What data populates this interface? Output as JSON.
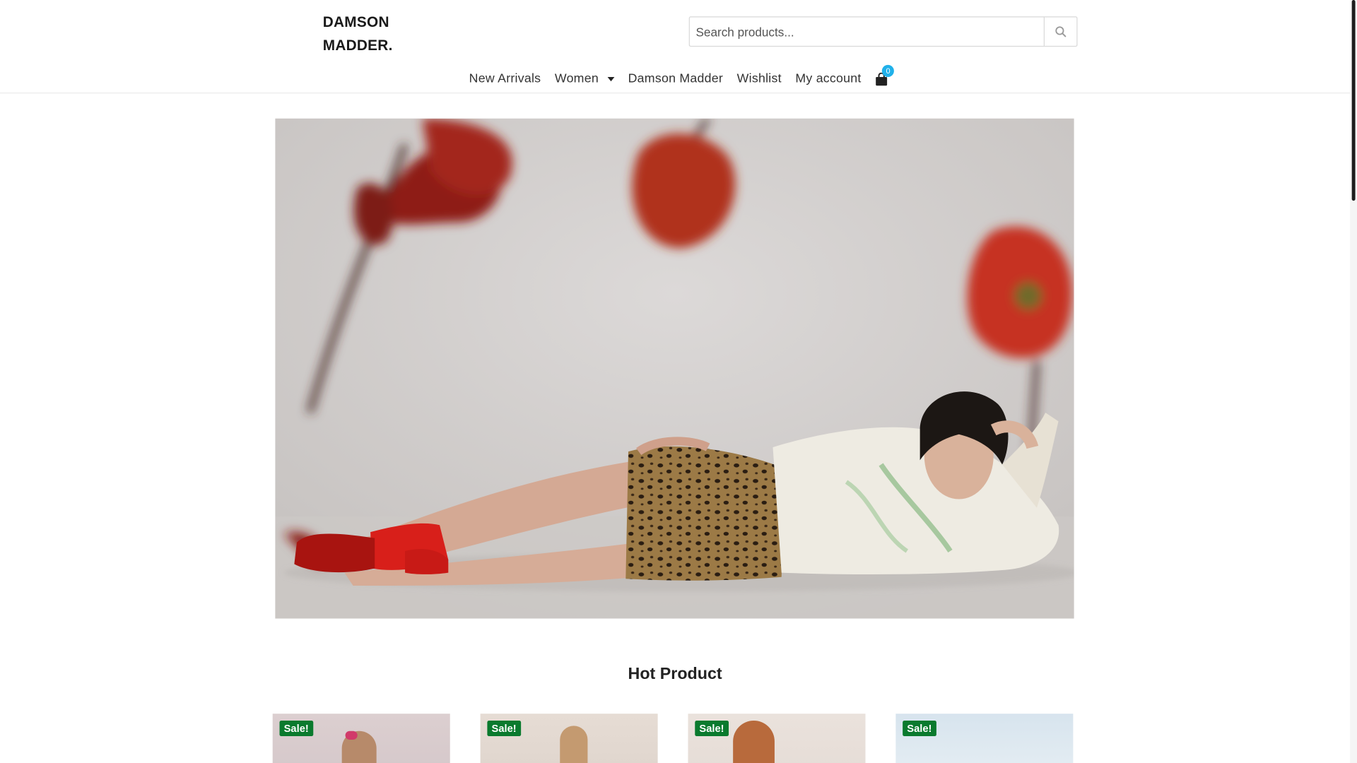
{
  "brand": {
    "line1": "DAMSON",
    "line2": "MADDER."
  },
  "search": {
    "placeholder": "Search products...",
    "value": "",
    "icon": "search-icon"
  },
  "nav": {
    "items": [
      {
        "label": "New Arrivals",
        "has_dropdown": false
      },
      {
        "label": "Women",
        "has_dropdown": true
      },
      {
        "label": "Damson Madder",
        "has_dropdown": false
      },
      {
        "label": "Wishlist",
        "has_dropdown": false
      },
      {
        "label": "My account",
        "has_dropdown": false
      }
    ],
    "cart": {
      "icon": "shopping-bag-icon",
      "count": "0"
    }
  },
  "hero": {
    "image": "campaign-photo-woman-lying-with-red-poppies"
  },
  "hot_product": {
    "title": "Hot Product",
    "products": [
      {
        "badge": "Sale!"
      },
      {
        "badge": "Sale!"
      },
      {
        "badge": "Sale!"
      },
      {
        "badge": "Sale!"
      }
    ]
  },
  "colors": {
    "accent": "#20b1ea",
    "sale_badge": "#0a7a2e",
    "text": "#222222",
    "border": "#d9d9d9"
  }
}
